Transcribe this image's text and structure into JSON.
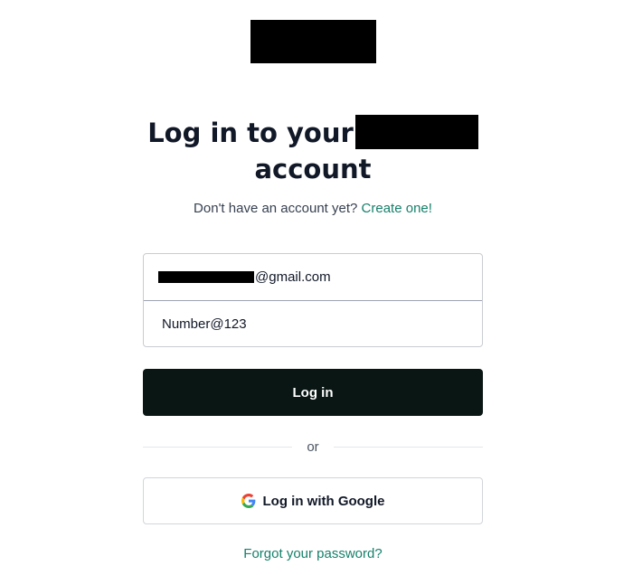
{
  "heading": {
    "line1": "Log in to your",
    "line2": "account"
  },
  "signup": {
    "prompt": "Don't have an account yet?",
    "link": "Create one!"
  },
  "form": {
    "email_suffix": "@gmail.com",
    "password_value": "Number@123"
  },
  "buttons": {
    "login": "Log in",
    "google": "Log in with Google"
  },
  "divider": {
    "label": "or"
  },
  "links": {
    "forgot_password": "Forgot your password?"
  },
  "colors": {
    "link": "#16806a",
    "primary_button": "#091614",
    "text": "#111827"
  },
  "icons": {
    "google": "google-g-icon"
  }
}
